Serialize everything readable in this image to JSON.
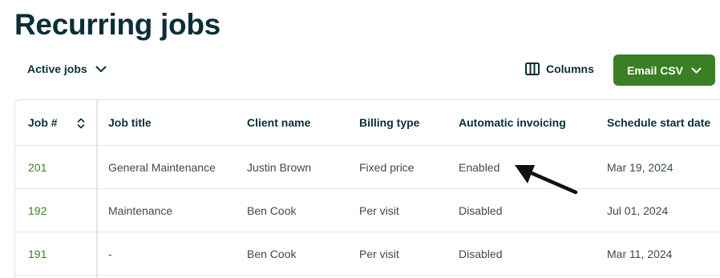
{
  "page": {
    "title": "Recurring jobs"
  },
  "toolbar": {
    "filter_label": "Active jobs",
    "columns_label": "Columns",
    "email_label": "Email CSV"
  },
  "table": {
    "headers": {
      "job": "Job #",
      "title": "Job title",
      "client": "Client name",
      "billing": "Billing type",
      "invoicing": "Automatic invoicing",
      "start": "Schedule start date"
    },
    "rows": [
      {
        "job": "201",
        "title": "General Maintenance",
        "client": "Justin Brown",
        "billing": "Fixed price",
        "invoicing": "Enabled",
        "start": "Mar 19, 2024"
      },
      {
        "job": "192",
        "title": "Maintenance",
        "client": "Ben Cook",
        "billing": "Per visit",
        "invoicing": "Disabled",
        "start": "Jul 01, 2024"
      },
      {
        "job": "191",
        "title": "-",
        "client": "Ben Cook",
        "billing": "Per visit",
        "invoicing": "Disabled",
        "start": "Mar 11, 2024"
      }
    ]
  },
  "colors": {
    "brand_green": "#3a7f24",
    "heading": "#0b2e37",
    "annotation_arrow": "#111111"
  }
}
